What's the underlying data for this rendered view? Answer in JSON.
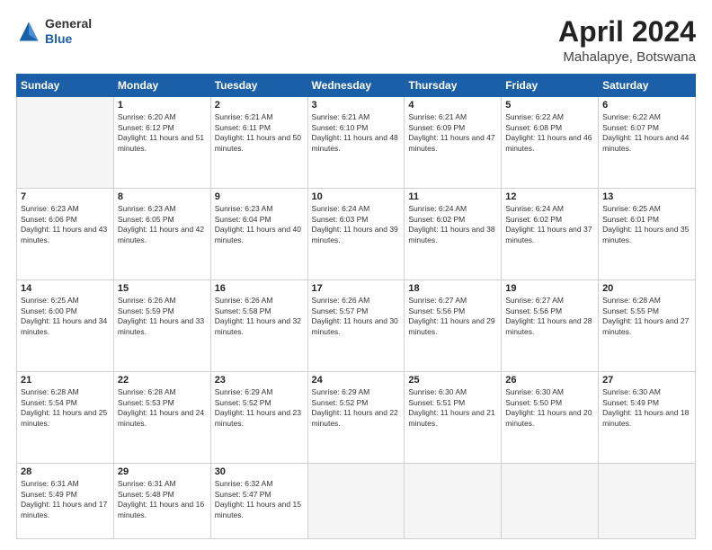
{
  "logo": {
    "general": "General",
    "blue": "Blue"
  },
  "header": {
    "month": "April 2024",
    "location": "Mahalapye, Botswana"
  },
  "weekdays": [
    "Sunday",
    "Monday",
    "Tuesday",
    "Wednesday",
    "Thursday",
    "Friday",
    "Saturday"
  ],
  "weeks": [
    [
      {
        "day": "",
        "empty": true
      },
      {
        "day": "1",
        "sunrise": "Sunrise: 6:20 AM",
        "sunset": "Sunset: 6:12 PM",
        "daylight": "Daylight: 11 hours and 51 minutes."
      },
      {
        "day": "2",
        "sunrise": "Sunrise: 6:21 AM",
        "sunset": "Sunset: 6:11 PM",
        "daylight": "Daylight: 11 hours and 50 minutes."
      },
      {
        "day": "3",
        "sunrise": "Sunrise: 6:21 AM",
        "sunset": "Sunset: 6:10 PM",
        "daylight": "Daylight: 11 hours and 48 minutes."
      },
      {
        "day": "4",
        "sunrise": "Sunrise: 6:21 AM",
        "sunset": "Sunset: 6:09 PM",
        "daylight": "Daylight: 11 hours and 47 minutes."
      },
      {
        "day": "5",
        "sunrise": "Sunrise: 6:22 AM",
        "sunset": "Sunset: 6:08 PM",
        "daylight": "Daylight: 11 hours and 46 minutes."
      },
      {
        "day": "6",
        "sunrise": "Sunrise: 6:22 AM",
        "sunset": "Sunset: 6:07 PM",
        "daylight": "Daylight: 11 hours and 44 minutes."
      }
    ],
    [
      {
        "day": "7",
        "sunrise": "Sunrise: 6:23 AM",
        "sunset": "Sunset: 6:06 PM",
        "daylight": "Daylight: 11 hours and 43 minutes."
      },
      {
        "day": "8",
        "sunrise": "Sunrise: 6:23 AM",
        "sunset": "Sunset: 6:05 PM",
        "daylight": "Daylight: 11 hours and 42 minutes."
      },
      {
        "day": "9",
        "sunrise": "Sunrise: 6:23 AM",
        "sunset": "Sunset: 6:04 PM",
        "daylight": "Daylight: 11 hours and 40 minutes."
      },
      {
        "day": "10",
        "sunrise": "Sunrise: 6:24 AM",
        "sunset": "Sunset: 6:03 PM",
        "daylight": "Daylight: 11 hours and 39 minutes."
      },
      {
        "day": "11",
        "sunrise": "Sunrise: 6:24 AM",
        "sunset": "Sunset: 6:02 PM",
        "daylight": "Daylight: 11 hours and 38 minutes."
      },
      {
        "day": "12",
        "sunrise": "Sunrise: 6:24 AM",
        "sunset": "Sunset: 6:02 PM",
        "daylight": "Daylight: 11 hours and 37 minutes."
      },
      {
        "day": "13",
        "sunrise": "Sunrise: 6:25 AM",
        "sunset": "Sunset: 6:01 PM",
        "daylight": "Daylight: 11 hours and 35 minutes."
      }
    ],
    [
      {
        "day": "14",
        "sunrise": "Sunrise: 6:25 AM",
        "sunset": "Sunset: 6:00 PM",
        "daylight": "Daylight: 11 hours and 34 minutes."
      },
      {
        "day": "15",
        "sunrise": "Sunrise: 6:26 AM",
        "sunset": "Sunset: 5:59 PM",
        "daylight": "Daylight: 11 hours and 33 minutes."
      },
      {
        "day": "16",
        "sunrise": "Sunrise: 6:26 AM",
        "sunset": "Sunset: 5:58 PM",
        "daylight": "Daylight: 11 hours and 32 minutes."
      },
      {
        "day": "17",
        "sunrise": "Sunrise: 6:26 AM",
        "sunset": "Sunset: 5:57 PM",
        "daylight": "Daylight: 11 hours and 30 minutes."
      },
      {
        "day": "18",
        "sunrise": "Sunrise: 6:27 AM",
        "sunset": "Sunset: 5:56 PM",
        "daylight": "Daylight: 11 hours and 29 minutes."
      },
      {
        "day": "19",
        "sunrise": "Sunrise: 6:27 AM",
        "sunset": "Sunset: 5:56 PM",
        "daylight": "Daylight: 11 hours and 28 minutes."
      },
      {
        "day": "20",
        "sunrise": "Sunrise: 6:28 AM",
        "sunset": "Sunset: 5:55 PM",
        "daylight": "Daylight: 11 hours and 27 minutes."
      }
    ],
    [
      {
        "day": "21",
        "sunrise": "Sunrise: 6:28 AM",
        "sunset": "Sunset: 5:54 PM",
        "daylight": "Daylight: 11 hours and 25 minutes."
      },
      {
        "day": "22",
        "sunrise": "Sunrise: 6:28 AM",
        "sunset": "Sunset: 5:53 PM",
        "daylight": "Daylight: 11 hours and 24 minutes."
      },
      {
        "day": "23",
        "sunrise": "Sunrise: 6:29 AM",
        "sunset": "Sunset: 5:52 PM",
        "daylight": "Daylight: 11 hours and 23 minutes."
      },
      {
        "day": "24",
        "sunrise": "Sunrise: 6:29 AM",
        "sunset": "Sunset: 5:52 PM",
        "daylight": "Daylight: 11 hours and 22 minutes."
      },
      {
        "day": "25",
        "sunrise": "Sunrise: 6:30 AM",
        "sunset": "Sunset: 5:51 PM",
        "daylight": "Daylight: 11 hours and 21 minutes."
      },
      {
        "day": "26",
        "sunrise": "Sunrise: 6:30 AM",
        "sunset": "Sunset: 5:50 PM",
        "daylight": "Daylight: 11 hours and 20 minutes."
      },
      {
        "day": "27",
        "sunrise": "Sunrise: 6:30 AM",
        "sunset": "Sunset: 5:49 PM",
        "daylight": "Daylight: 11 hours and 18 minutes."
      }
    ],
    [
      {
        "day": "28",
        "sunrise": "Sunrise: 6:31 AM",
        "sunset": "Sunset: 5:49 PM",
        "daylight": "Daylight: 11 hours and 17 minutes."
      },
      {
        "day": "29",
        "sunrise": "Sunrise: 6:31 AM",
        "sunset": "Sunset: 5:48 PM",
        "daylight": "Daylight: 11 hours and 16 minutes."
      },
      {
        "day": "30",
        "sunrise": "Sunrise: 6:32 AM",
        "sunset": "Sunset: 5:47 PM",
        "daylight": "Daylight: 11 hours and 15 minutes."
      },
      {
        "day": "",
        "empty": true
      },
      {
        "day": "",
        "empty": true
      },
      {
        "day": "",
        "empty": true
      },
      {
        "day": "",
        "empty": true
      }
    ]
  ]
}
